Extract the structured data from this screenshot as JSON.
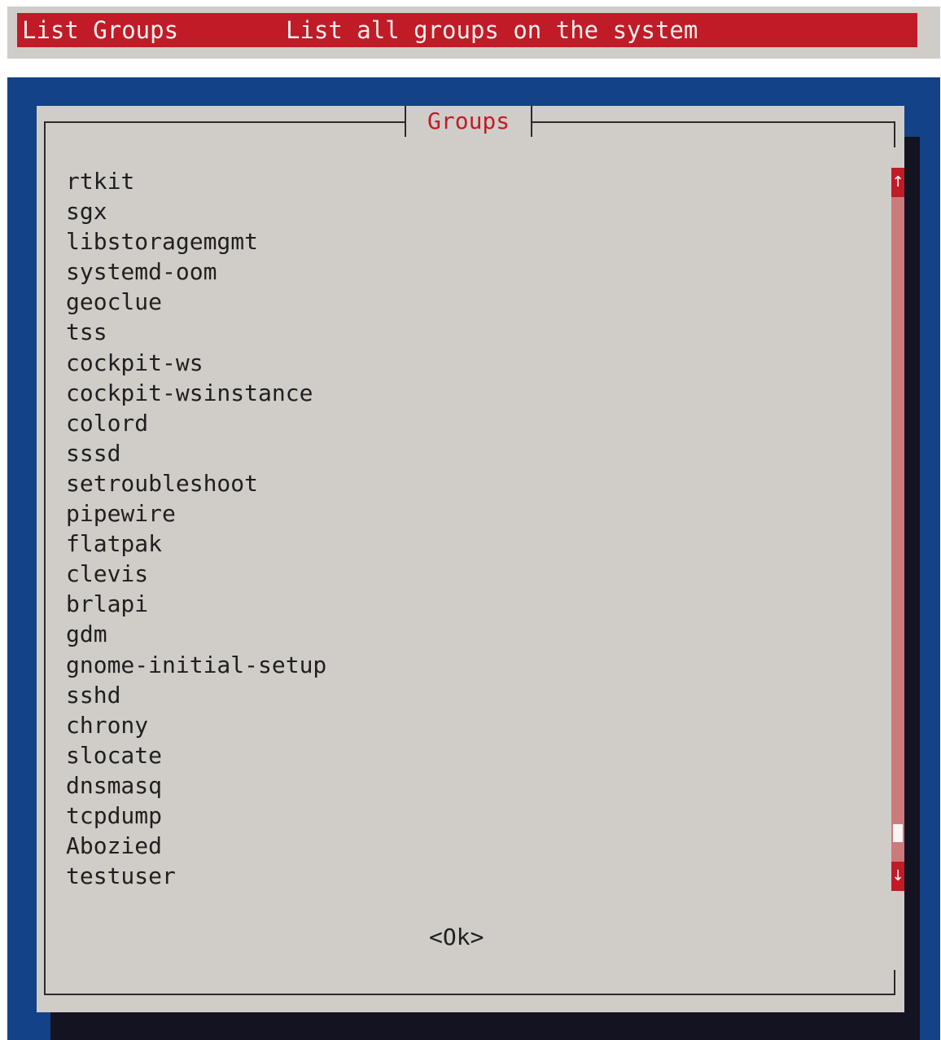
{
  "menu": {
    "selected": {
      "name": "List Groups",
      "description": "List all groups on the system"
    }
  },
  "dialog": {
    "title": "Groups",
    "groups": [
      "rtkit",
      "sgx",
      "libstoragemgmt",
      "systemd-oom",
      "geoclue",
      "tss",
      "cockpit-ws",
      "cockpit-wsinstance",
      "colord",
      "sssd",
      "setroubleshoot",
      "pipewire",
      "flatpak",
      "clevis",
      "brlapi",
      "gdm",
      "gnome-initial-setup",
      "sshd",
      "chrony",
      "slocate",
      "dnsmasq",
      "tcpdump",
      "Abozied",
      "testuser"
    ],
    "ok_label": "<Ok>",
    "scroll": {
      "up_icon": "arrow-up-icon",
      "down_icon": "arrow-down-icon",
      "up_glyph": "↑",
      "down_glyph": "↓",
      "position": 0.97
    }
  },
  "colors": {
    "backdrop": "#134289",
    "dialog_bg": "#d0cdc9",
    "accent": "#c11b28",
    "scroll_track": "#cc7a7c",
    "shadow": "#141321"
  }
}
